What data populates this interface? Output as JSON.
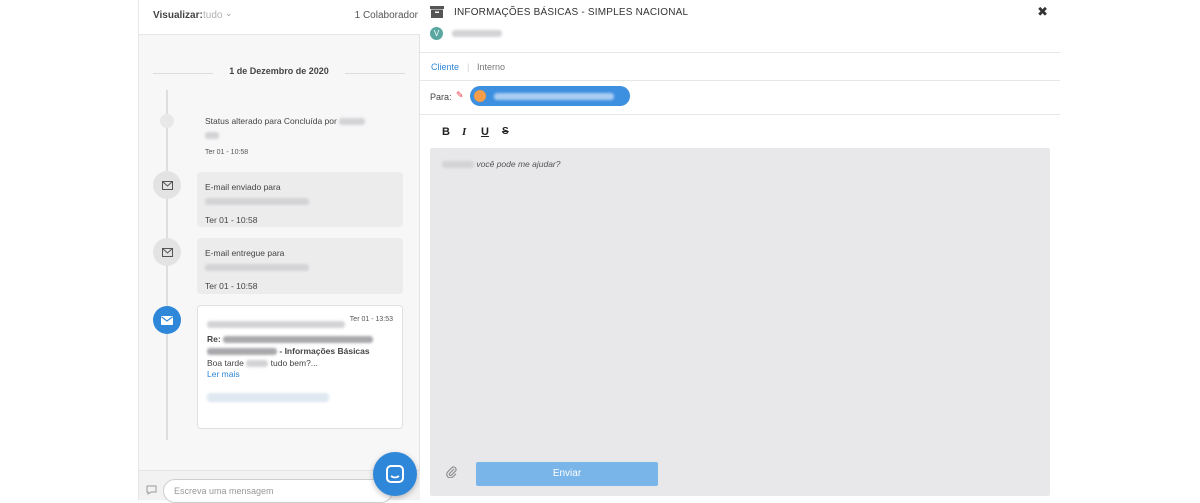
{
  "left": {
    "view_label": "Visualizar:",
    "view_value": "tudo",
    "collaborators": "1 Colaborador",
    "date": "1 de Dezembro de 2020",
    "events": [
      {
        "text": "Status alterado para Concluída por",
        "time": "Ter 01 - 10:58"
      },
      {
        "text": "E-mail enviado para",
        "time": "Ter 01 - 10:58"
      },
      {
        "text": "E-mail entregue para",
        "time": "Ter 01 - 10:58"
      }
    ],
    "email_card": {
      "time": "Ter 01 - 13:53",
      "re": "Re:",
      "subject_suffix": "- Informações Básicas",
      "greeting": "Boa tarde",
      "greeting_end": "tudo bem?...",
      "read_more": "Ler mais"
    },
    "message_placeholder": "Escreva uma mensagem"
  },
  "right": {
    "title": "INFORMAÇÕES BÁSICAS - SIMPLES NACIONAL",
    "close": "✖",
    "badge": "V",
    "tabs": [
      {
        "label": "Cliente",
        "active": true
      },
      {
        "label": "Interno",
        "active": false
      }
    ],
    "to_label": "Para:",
    "format_bold": "B",
    "format_italic": "I",
    "format_underline": "U",
    "format_strike": "S",
    "editor_text": "você pode me ajudar?",
    "send_label": "Enviar"
  },
  "colors": {
    "accent": "#2e87d9",
    "send_button": "#7ab5ea",
    "editor_bg": "#e8e8ea"
  }
}
